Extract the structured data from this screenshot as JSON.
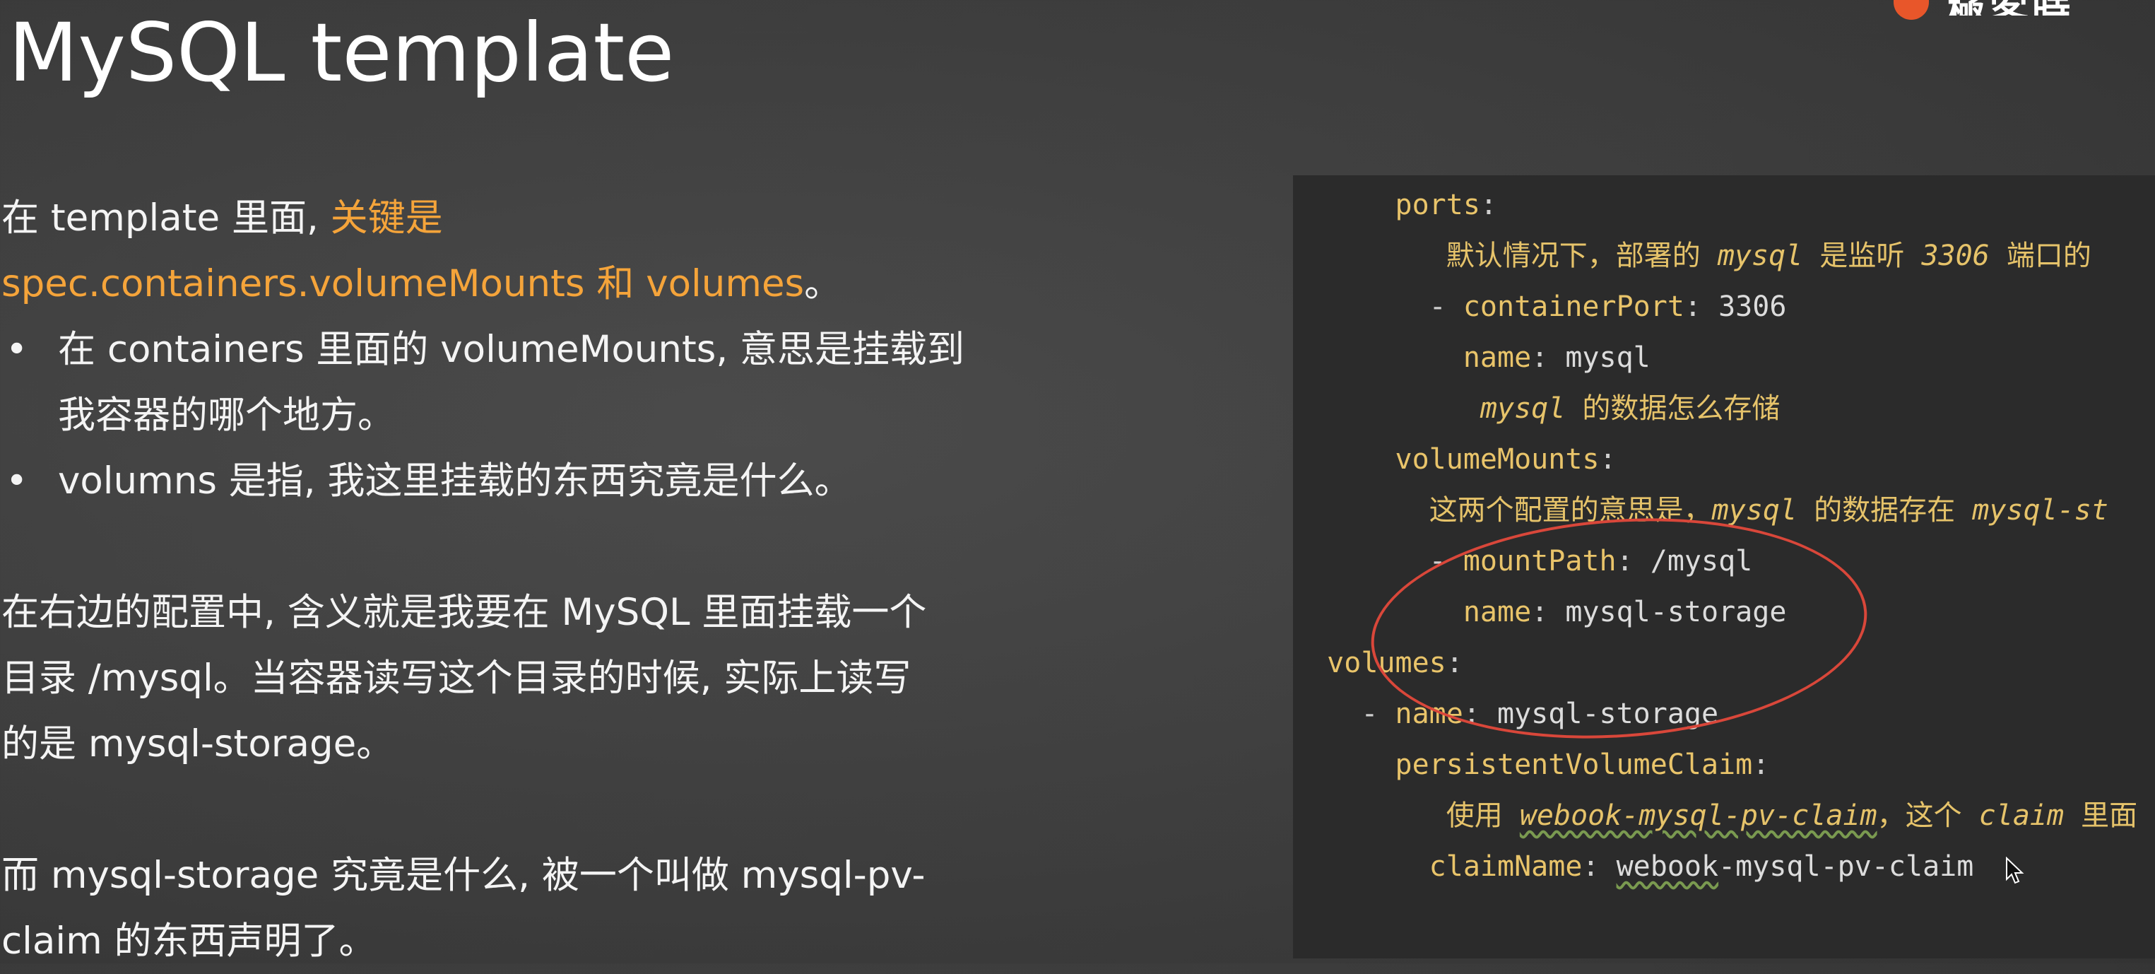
{
  "slide": {
    "title": "MySQL template",
    "intro_prefix": "在 template 里面, ",
    "intro_highlight_1": "关键是",
    "intro_highlight_2": "spec.containers.volumeMounts 和 volumes",
    "intro_suffix": "。",
    "bullets": [
      {
        "line1": "在 containers 里面的 volumeMounts, 意思是挂载到",
        "line2": "我容器的哪个地方。"
      },
      {
        "line1": "volumns 是指, 我这里挂载的东西究竟是什么。"
      }
    ],
    "para2": [
      "在右边的配置中, 含义就是我要在 MySQL 里面挂载一个",
      "目录 /mysql。当容器读写这个目录的时候, 实际上读写",
      "的是 mysql-storage。"
    ],
    "para3": [
      "而 mysql-storage 究竟是什么, 被一个叫做 mysql-pv-",
      "claim 的东西声明了。"
    ]
  },
  "code": {
    "ports_key": "ports",
    "comment_ports_1": "默认情况下，部署的 ",
    "comment_ports_2": "mysql",
    "comment_ports_3": " 是监听 ",
    "comment_ports_4": "3306",
    "comment_ports_5": " 端口的",
    "containerPort_key": "containerPort",
    "containerPort_val": "3306",
    "port_name_key": "name",
    "port_name_val": "mysql",
    "comment_store_1": "mysql",
    "comment_store_2": " 的数据怎么存储",
    "volumeMounts_key": "volumeMounts",
    "comment_mounts_1": "这两个配置的意思是，",
    "comment_mounts_2": "mysql",
    "comment_mounts_3": " 的数据存在 ",
    "comment_mounts_4": "mysql-st",
    "mountPath_key": "mountPath",
    "mountPath_val": "/mysql",
    "mount_name_key": "name",
    "mount_name_val": "mysql-storage",
    "volumes_key": "volumes",
    "vol_name_key": "name",
    "vol_name_val": "mysql-storage",
    "pvc_key": "persistentVolumeClaim",
    "comment_pvc_1": "使用 ",
    "comment_pvc_2": "webook-mysql-pv-claim",
    "comment_pvc_3": "，这个 ",
    "comment_pvc_4": "claim",
    "comment_pvc_5": " 里面",
    "claimName_key": "claimName",
    "claimName_val_1": "webook",
    "claimName_val_2": "-mysql-pv-claim"
  },
  "colors": {
    "highlight": "#f5a43a",
    "yaml_key": "#e9c46a",
    "annotation_circle": "#d9473a",
    "code_bg": "#2b2b2b"
  }
}
